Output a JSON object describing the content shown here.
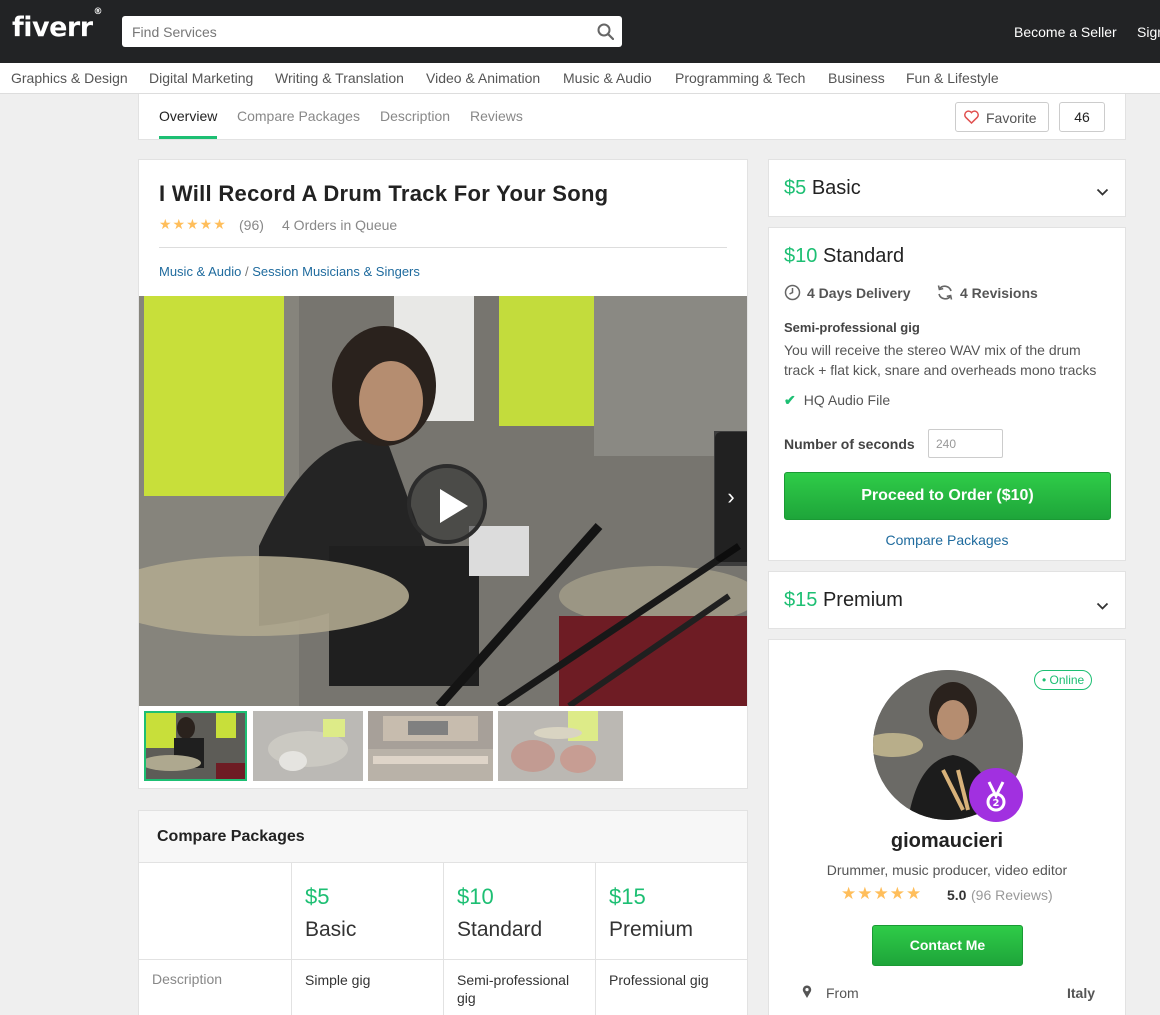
{
  "header": {
    "logo": "fiverr",
    "logo_mark": "®",
    "search_placeholder": "Find Services",
    "become_seller": "Become a Seller",
    "sign_in": "Sign"
  },
  "categories": [
    "Graphics & Design",
    "Digital Marketing",
    "Writing & Translation",
    "Video & Animation",
    "Music & Audio",
    "Programming & Tech",
    "Business",
    "Fun & Lifestyle"
  ],
  "subnav": {
    "tabs": [
      "Overview",
      "Compare Packages",
      "Description",
      "Reviews"
    ],
    "active_tab": "Overview",
    "favorite_label": "Favorite",
    "favorite_count": "46"
  },
  "gig": {
    "title": "I Will Record A Drum Track For Your Song",
    "rating_stars": 5,
    "review_count": "(96)",
    "queue": "4 Orders in Queue",
    "breadcrumb_category": "Music & Audio",
    "breadcrumb_separator": "/",
    "breadcrumb_subcategory": "Session Musicians & Singers",
    "thumbnail_count": 4
  },
  "compare": {
    "heading": "Compare Packages",
    "packages": [
      {
        "price": "$5",
        "name": "Basic",
        "description": "Simple gig"
      },
      {
        "price": "$10",
        "name": "Standard",
        "description": "Semi-professional gig"
      },
      {
        "price": "$15",
        "name": "Premium",
        "description": "Professional gig"
      }
    ],
    "row_label": "Description"
  },
  "packages": {
    "basic": {
      "price": "$5",
      "name": "Basic"
    },
    "standard": {
      "price": "$10",
      "name": "Standard",
      "delivery": "4 Days Delivery",
      "revisions": "4 Revisions",
      "subtitle": "Semi-professional gig",
      "description": "You will receive the stereo WAV mix of the drum track + flat kick, snare and overheads mono tracks",
      "feature": "HQ Audio File",
      "seconds_label": "Number of seconds",
      "seconds_value": "240",
      "order_button": "Proceed to Order ($10)",
      "compare_link": "Compare Packages"
    },
    "premium": {
      "price": "$15",
      "name": "Premium"
    }
  },
  "seller": {
    "status": "• Online",
    "username": "giomaucieri",
    "tagline": "Drummer, music producer, video editor",
    "rating": "5.0",
    "reviews": "(96 Reviews)",
    "contact_button": "Contact Me",
    "from_label": "From",
    "country": "Italy"
  },
  "colors": {
    "brand_green": "#1dbf73",
    "header_bg": "#222325",
    "star": "#ffbe5b",
    "link_blue": "#1f6b9e",
    "badge_purple": "#a130e0"
  }
}
